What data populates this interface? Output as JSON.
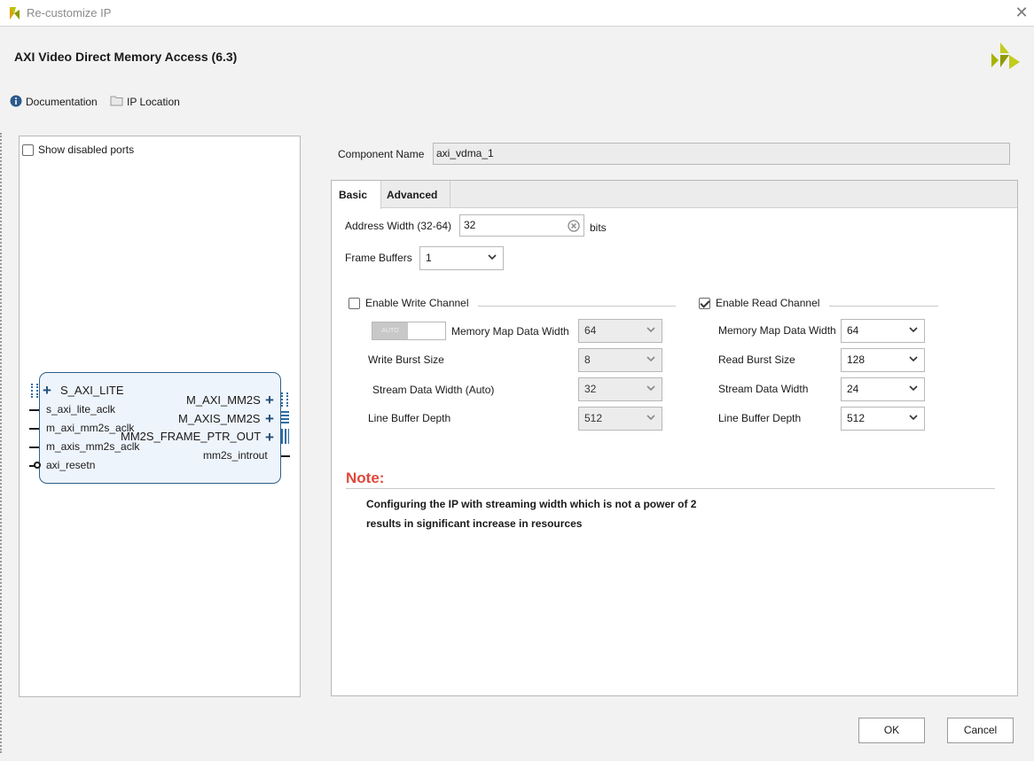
{
  "window": {
    "title": "Re-customize IP",
    "close": "✕"
  },
  "header": {
    "title": "AXI Video Direct Memory Access (6.3)",
    "links": {
      "documentation": "Documentation",
      "ip_location": "IP Location"
    }
  },
  "left_panel": {
    "show_disabled_ports_label": "Show disabled ports",
    "show_disabled_ports_checked": false,
    "ip_symbol": {
      "left_ports": [
        "S_AXI_LITE",
        "s_axi_lite_aclk",
        "m_axi_mm2s_aclk",
        "m_axis_mm2s_aclk",
        "axi_resetn"
      ],
      "right_ports": [
        "M_AXI_MM2S",
        "M_AXIS_MM2S",
        "MM2S_FRAME_PTR_OUT",
        "mm2s_introut"
      ]
    }
  },
  "component": {
    "label": "Component Name",
    "value": "axi_vdma_1"
  },
  "tabs": [
    {
      "label": "Basic",
      "active": true
    },
    {
      "label": "Advanced",
      "active": false
    }
  ],
  "basic": {
    "address_width": {
      "label": "Address Width (32-64)",
      "value": "32",
      "unit": "bits"
    },
    "frame_buffers": {
      "label": "Frame Buffers",
      "value": "1"
    },
    "write_channel": {
      "label": "Enable Write Channel",
      "checked": false,
      "auto_toggle_label": "AUTO",
      "memory_map_data_width": {
        "label": "Memory Map Data Width",
        "value": "64"
      },
      "burst_size": {
        "label": "Write Burst Size",
        "value": "8"
      },
      "stream_data_width": {
        "label": "Stream Data Width (Auto)",
        "value": "32"
      },
      "line_buffer_depth": {
        "label": "Line Buffer Depth",
        "value": "512"
      }
    },
    "read_channel": {
      "label": "Enable Read Channel",
      "checked": true,
      "memory_map_data_width": {
        "label": "Memory Map Data Width",
        "value": "64"
      },
      "burst_size": {
        "label": "Read Burst Size",
        "value": "128"
      },
      "stream_data_width": {
        "label": "Stream Data Width",
        "value": "24"
      },
      "line_buffer_depth": {
        "label": "Line Buffer Depth",
        "value": "512"
      }
    },
    "note": {
      "title": "Note:",
      "line1": "Configuring the IP with streaming width which is not a power of 2",
      "line2": "results in significant increase in resources"
    }
  },
  "footer": {
    "ok": "OK",
    "cancel": "Cancel"
  },
  "colors": {
    "note": "#e0483b",
    "ip_block_border": "#2e5f8a",
    "ip_block_fill": "#eef4fb",
    "logo": "#a8b400"
  }
}
